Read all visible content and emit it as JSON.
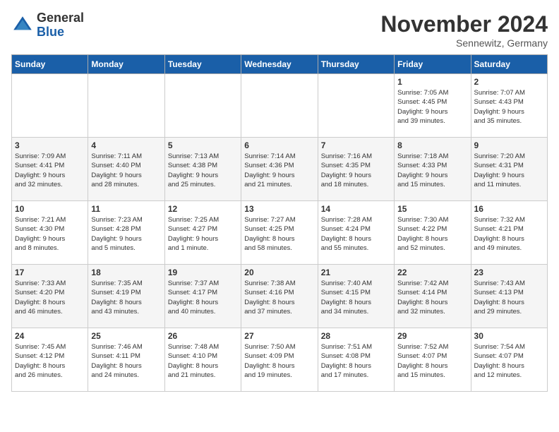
{
  "header": {
    "logo_general": "General",
    "logo_blue": "Blue",
    "month_title": "November 2024",
    "location": "Sennewitz, Germany"
  },
  "days_of_week": [
    "Sunday",
    "Monday",
    "Tuesday",
    "Wednesday",
    "Thursday",
    "Friday",
    "Saturday"
  ],
  "weeks": [
    [
      {
        "day": "",
        "info": ""
      },
      {
        "day": "",
        "info": ""
      },
      {
        "day": "",
        "info": ""
      },
      {
        "day": "",
        "info": ""
      },
      {
        "day": "",
        "info": ""
      },
      {
        "day": "1",
        "info": "Sunrise: 7:05 AM\nSunset: 4:45 PM\nDaylight: 9 hours\nand 39 minutes."
      },
      {
        "day": "2",
        "info": "Sunrise: 7:07 AM\nSunset: 4:43 PM\nDaylight: 9 hours\nand 35 minutes."
      }
    ],
    [
      {
        "day": "3",
        "info": "Sunrise: 7:09 AM\nSunset: 4:41 PM\nDaylight: 9 hours\nand 32 minutes."
      },
      {
        "day": "4",
        "info": "Sunrise: 7:11 AM\nSunset: 4:40 PM\nDaylight: 9 hours\nand 28 minutes."
      },
      {
        "day": "5",
        "info": "Sunrise: 7:13 AM\nSunset: 4:38 PM\nDaylight: 9 hours\nand 25 minutes."
      },
      {
        "day": "6",
        "info": "Sunrise: 7:14 AM\nSunset: 4:36 PM\nDaylight: 9 hours\nand 21 minutes."
      },
      {
        "day": "7",
        "info": "Sunrise: 7:16 AM\nSunset: 4:35 PM\nDaylight: 9 hours\nand 18 minutes."
      },
      {
        "day": "8",
        "info": "Sunrise: 7:18 AM\nSunset: 4:33 PM\nDaylight: 9 hours\nand 15 minutes."
      },
      {
        "day": "9",
        "info": "Sunrise: 7:20 AM\nSunset: 4:31 PM\nDaylight: 9 hours\nand 11 minutes."
      }
    ],
    [
      {
        "day": "10",
        "info": "Sunrise: 7:21 AM\nSunset: 4:30 PM\nDaylight: 9 hours\nand 8 minutes."
      },
      {
        "day": "11",
        "info": "Sunrise: 7:23 AM\nSunset: 4:28 PM\nDaylight: 9 hours\nand 5 minutes."
      },
      {
        "day": "12",
        "info": "Sunrise: 7:25 AM\nSunset: 4:27 PM\nDaylight: 9 hours\nand 1 minute."
      },
      {
        "day": "13",
        "info": "Sunrise: 7:27 AM\nSunset: 4:25 PM\nDaylight: 8 hours\nand 58 minutes."
      },
      {
        "day": "14",
        "info": "Sunrise: 7:28 AM\nSunset: 4:24 PM\nDaylight: 8 hours\nand 55 minutes."
      },
      {
        "day": "15",
        "info": "Sunrise: 7:30 AM\nSunset: 4:22 PM\nDaylight: 8 hours\nand 52 minutes."
      },
      {
        "day": "16",
        "info": "Sunrise: 7:32 AM\nSunset: 4:21 PM\nDaylight: 8 hours\nand 49 minutes."
      }
    ],
    [
      {
        "day": "17",
        "info": "Sunrise: 7:33 AM\nSunset: 4:20 PM\nDaylight: 8 hours\nand 46 minutes."
      },
      {
        "day": "18",
        "info": "Sunrise: 7:35 AM\nSunset: 4:19 PM\nDaylight: 8 hours\nand 43 minutes."
      },
      {
        "day": "19",
        "info": "Sunrise: 7:37 AM\nSunset: 4:17 PM\nDaylight: 8 hours\nand 40 minutes."
      },
      {
        "day": "20",
        "info": "Sunrise: 7:38 AM\nSunset: 4:16 PM\nDaylight: 8 hours\nand 37 minutes."
      },
      {
        "day": "21",
        "info": "Sunrise: 7:40 AM\nSunset: 4:15 PM\nDaylight: 8 hours\nand 34 minutes."
      },
      {
        "day": "22",
        "info": "Sunrise: 7:42 AM\nSunset: 4:14 PM\nDaylight: 8 hours\nand 32 minutes."
      },
      {
        "day": "23",
        "info": "Sunrise: 7:43 AM\nSunset: 4:13 PM\nDaylight: 8 hours\nand 29 minutes."
      }
    ],
    [
      {
        "day": "24",
        "info": "Sunrise: 7:45 AM\nSunset: 4:12 PM\nDaylight: 8 hours\nand 26 minutes."
      },
      {
        "day": "25",
        "info": "Sunrise: 7:46 AM\nSunset: 4:11 PM\nDaylight: 8 hours\nand 24 minutes."
      },
      {
        "day": "26",
        "info": "Sunrise: 7:48 AM\nSunset: 4:10 PM\nDaylight: 8 hours\nand 21 minutes."
      },
      {
        "day": "27",
        "info": "Sunrise: 7:50 AM\nSunset: 4:09 PM\nDaylight: 8 hours\nand 19 minutes."
      },
      {
        "day": "28",
        "info": "Sunrise: 7:51 AM\nSunset: 4:08 PM\nDaylight: 8 hours\nand 17 minutes."
      },
      {
        "day": "29",
        "info": "Sunrise: 7:52 AM\nSunset: 4:07 PM\nDaylight: 8 hours\nand 15 minutes."
      },
      {
        "day": "30",
        "info": "Sunrise: 7:54 AM\nSunset: 4:07 PM\nDaylight: 8 hours\nand 12 minutes."
      }
    ]
  ]
}
